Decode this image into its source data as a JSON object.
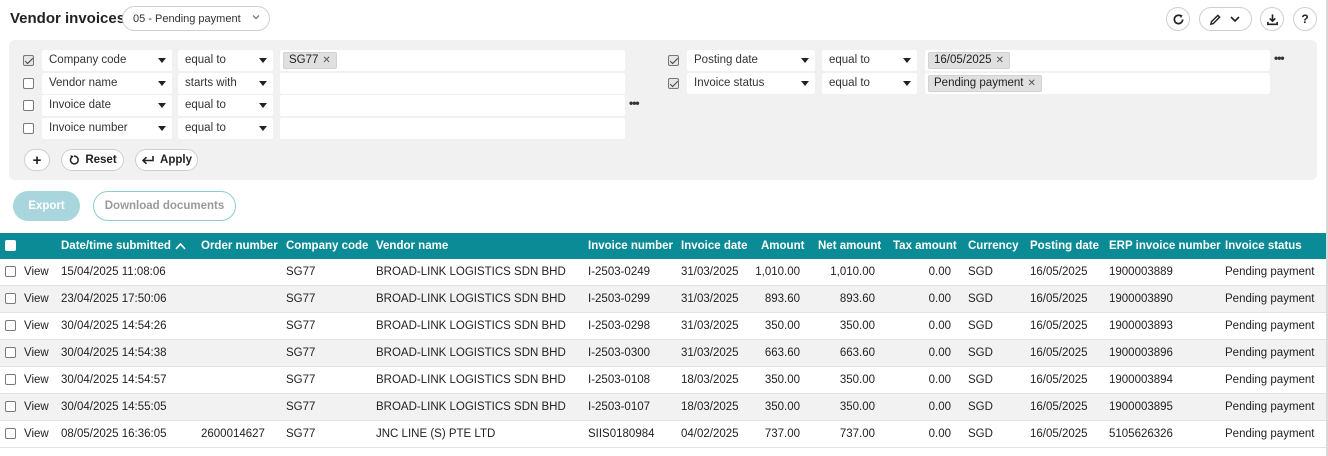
{
  "header": {
    "title": "Vendor invoices",
    "view_select": "05 - Pending payment",
    "help_label": "?"
  },
  "filters": {
    "left": [
      {
        "checked": true,
        "field": "Company code",
        "operator": "equal to",
        "value_chip": "SG77"
      },
      {
        "checked": false,
        "field": "Vendor name",
        "operator": "starts with",
        "value_chip": ""
      },
      {
        "checked": false,
        "field": "Invoice date",
        "operator": "equal to",
        "value_chip": ""
      },
      {
        "checked": false,
        "field": "Invoice number",
        "operator": "equal to",
        "value_chip": ""
      }
    ],
    "right": [
      {
        "checked": true,
        "field": "Posting date",
        "operator": "equal to",
        "value_chip": "16/05/2025"
      },
      {
        "checked": true,
        "field": "Invoice status",
        "operator": "equal to",
        "value_chip": "Pending payment"
      }
    ],
    "more_label": "•••",
    "add_label": "+",
    "reset_label": "Reset",
    "apply_label": "Apply"
  },
  "actions": {
    "export_label": "Export",
    "download_label": "Download documents"
  },
  "table": {
    "columns": [
      "Date/time submitted",
      "Order number",
      "Company code",
      "Vendor name",
      "Invoice number",
      "Invoice date",
      "Amount",
      "Net amount",
      "Tax amount",
      "Currency",
      "Posting date",
      "ERP invoice number",
      "Invoice status"
    ],
    "sorted_column": "Date/time submitted",
    "sort_direction": "ascending",
    "view_label": "View",
    "rows": [
      [
        "15/04/2025 11:08:06",
        "",
        "SG77",
        "BROAD-LINK LOGISTICS SDN BHD",
        "I-2503-0249",
        "31/03/2025",
        "1,010.00",
        "1,010.00",
        "0.00",
        "SGD",
        "16/05/2025",
        "1900003889",
        "Pending payment"
      ],
      [
        "23/04/2025 17:50:06",
        "",
        "SG77",
        "BROAD-LINK LOGISTICS SDN BHD",
        "I-2503-0299",
        "31/03/2025",
        "893.60",
        "893.60",
        "0.00",
        "SGD",
        "16/05/2025",
        "1900003890",
        "Pending payment"
      ],
      [
        "30/04/2025 14:54:26",
        "",
        "SG77",
        "BROAD-LINK LOGISTICS SDN BHD",
        "I-2503-0298",
        "31/03/2025",
        "350.00",
        "350.00",
        "0.00",
        "SGD",
        "16/05/2025",
        "1900003893",
        "Pending payment"
      ],
      [
        "30/04/2025 14:54:38",
        "",
        "SG77",
        "BROAD-LINK LOGISTICS SDN BHD",
        "I-2503-0300",
        "31/03/2025",
        "663.60",
        "663.60",
        "0.00",
        "SGD",
        "16/05/2025",
        "1900003896",
        "Pending payment"
      ],
      [
        "30/04/2025 14:54:57",
        "",
        "SG77",
        "BROAD-LINK LOGISTICS SDN BHD",
        "I-2503-0108",
        "18/03/2025",
        "350.00",
        "350.00",
        "0.00",
        "SGD",
        "16/05/2025",
        "1900003894",
        "Pending payment"
      ],
      [
        "30/04/2025 14:55:05",
        "",
        "SG77",
        "BROAD-LINK LOGISTICS SDN BHD",
        "I-2503-0107",
        "18/03/2025",
        "350.00",
        "350.00",
        "0.00",
        "SGD",
        "16/05/2025",
        "1900003895",
        "Pending payment"
      ],
      [
        "08/05/2025 16:36:05",
        "2600014627",
        "SG77",
        "JNC LINE (S) PTE LTD",
        "SIIS0180984",
        "04/02/2025",
        "737.00",
        "737.00",
        "0.00",
        "SGD",
        "16/05/2025",
        "5105626326",
        "Pending payment"
      ]
    ]
  },
  "colors": {
    "table_header_bg": "#0b8b95",
    "export_button_bg": "#a8d6dc",
    "filter_panel_bg": "#f1f1f1",
    "alt_row_bg": "#f2f2f2"
  },
  "icons": [
    "refresh-icon",
    "pencil-icon",
    "chevron-down-icon",
    "download-icon",
    "help-icon",
    "reset-icon",
    "apply-icon",
    "close-icon",
    "sort-up-icon",
    "more-icon",
    "add-icon"
  ]
}
